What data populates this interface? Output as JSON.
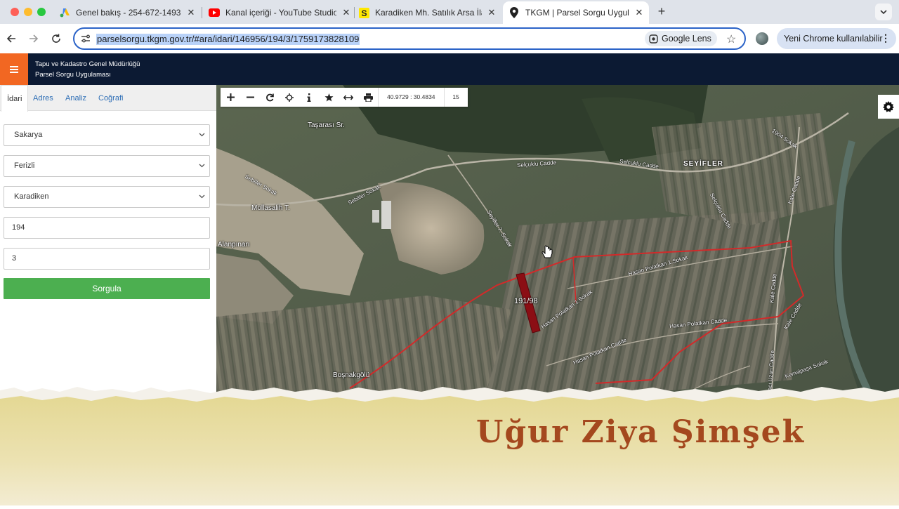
{
  "browser": {
    "tabs": [
      {
        "title": "Genel bakış - 254-672-1493",
        "favicon": "google-ads-icon"
      },
      {
        "title": "Kanal içeriği - YouTube Studio",
        "favicon": "youtube-icon"
      },
      {
        "title": "Karadiken Mh. Satılık Arsa İlanı",
        "favicon": "sahibinden-icon"
      },
      {
        "title": "TKGM | Parsel Sorgu Uygulaması",
        "favicon": "location-pin-icon",
        "active": true
      }
    ],
    "url": "parselsorgu.tkgm.gov.tr/#ara/idari/146956/194/3/1759173828109",
    "lens_label": "Google Lens",
    "update_label": "Yeni Chrome kullanılabilir"
  },
  "app": {
    "org": "Tapu ve Kadastro Genel Müdürlüğü",
    "name": "Parsel Sorgu Uygulaması"
  },
  "panel": {
    "tabs": [
      "İdari",
      "Adres",
      "Analiz",
      "Coğrafi"
    ],
    "active_tab": "İdari",
    "il": "Sakarya",
    "ilce": "Ferizli",
    "mahalle": "Karadiken",
    "ada": "194",
    "parsel": "3",
    "submit_label": "Sorgula"
  },
  "map": {
    "coordinates": "40.9729 : 30.4834",
    "zoom": "15",
    "parcel_label": "191/98",
    "places": {
      "tasarasi": "Taşarası Sr.",
      "seyifler": "SEYİFLER",
      "mollasalih": "Mollasalih T.",
      "alanpinari": "Alanpınarı",
      "bosnakgolu": "Boşnakgölü"
    },
    "streets": {
      "selcuklu1": "Selçuklu Cadde",
      "selcuklu2": "Selçuklu Cadde",
      "selcuklu3": "Selçuklu Cadde",
      "sebiller1": "Sebiller Sokak",
      "sebiller2": "Sebiller Sokak",
      "seyifler": "Seyifler 7. Sokak",
      "kale1": "Kale Cadde",
      "kale2": "Kale Cadde",
      "kale3": "Kale Cadde",
      "hasan1": "Hasan Polatkan 1.Sokak",
      "hasan2": "Hasan Polatkan 1.Sokak",
      "hasan3": "Hasan Polatkan Cadde",
      "hasan4": "Hasan Polatkan Cadde",
      "sokak1904": "1904 Sokak",
      "kemalpasa": "Kemalpaşa Sokak",
      "haciuzun": "Hacı Uzun Cadde"
    }
  },
  "banner": {
    "name": "Uğur Ziya Şimşek"
  },
  "colors": {
    "header_bg": "#0c1a33",
    "menu_orange": "#f26722",
    "submit_green": "#4caf50",
    "boundary_red": "#d22a2a",
    "parcel_fill": "#8b0e14",
    "banner_text": "#a4481e"
  }
}
